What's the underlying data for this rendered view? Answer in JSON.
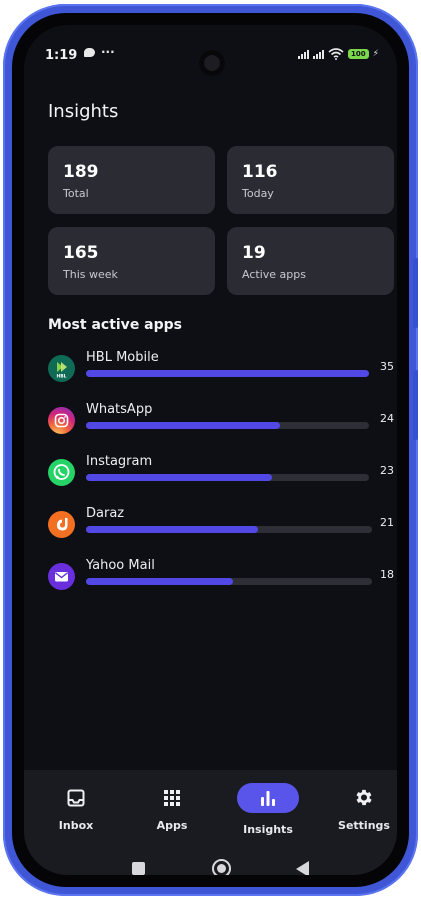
{
  "status_bar": {
    "time": "1:19",
    "overflow": "···",
    "battery_level": "100"
  },
  "page": {
    "title": "Insights"
  },
  "stats": [
    {
      "value": "189",
      "label": "Total"
    },
    {
      "value": "116",
      "label": "Today"
    },
    {
      "value": "165",
      "label": "This week"
    },
    {
      "value": "19",
      "label": "Active apps"
    }
  ],
  "most_active": {
    "title": "Most active apps",
    "apps": [
      {
        "name": "HBL Mobile",
        "count": "35",
        "fraction": 1.0,
        "icon_text": "HBL",
        "icon": "hbl-app-icon"
      },
      {
        "name": "WhatsApp",
        "count": "24",
        "fraction": 0.686,
        "icon": "instagram-icon"
      },
      {
        "name": "Instagram",
        "count": "23",
        "fraction": 0.657,
        "icon": "whatsapp-icon"
      },
      {
        "name": "Daraz",
        "count": "21",
        "fraction": 0.6,
        "icon": "daraz-icon"
      },
      {
        "name": "Yahoo Mail",
        "count": "18",
        "fraction": 0.514,
        "icon": "mail-icon"
      }
    ]
  },
  "bottom_nav": {
    "items": [
      {
        "label": "Inbox",
        "icon": "inbox-icon"
      },
      {
        "label": "Apps",
        "icon": "grid-icon"
      },
      {
        "label": "Insights",
        "icon": "bar-chart-icon",
        "active": true
      },
      {
        "label": "Settings",
        "icon": "gear-icon"
      }
    ]
  },
  "colors": {
    "accent": "#5a55ea",
    "bar_fill": "#5248e6",
    "background": "#0e0f14",
    "card": "#2b2c33",
    "frame": "#3f57d6"
  }
}
